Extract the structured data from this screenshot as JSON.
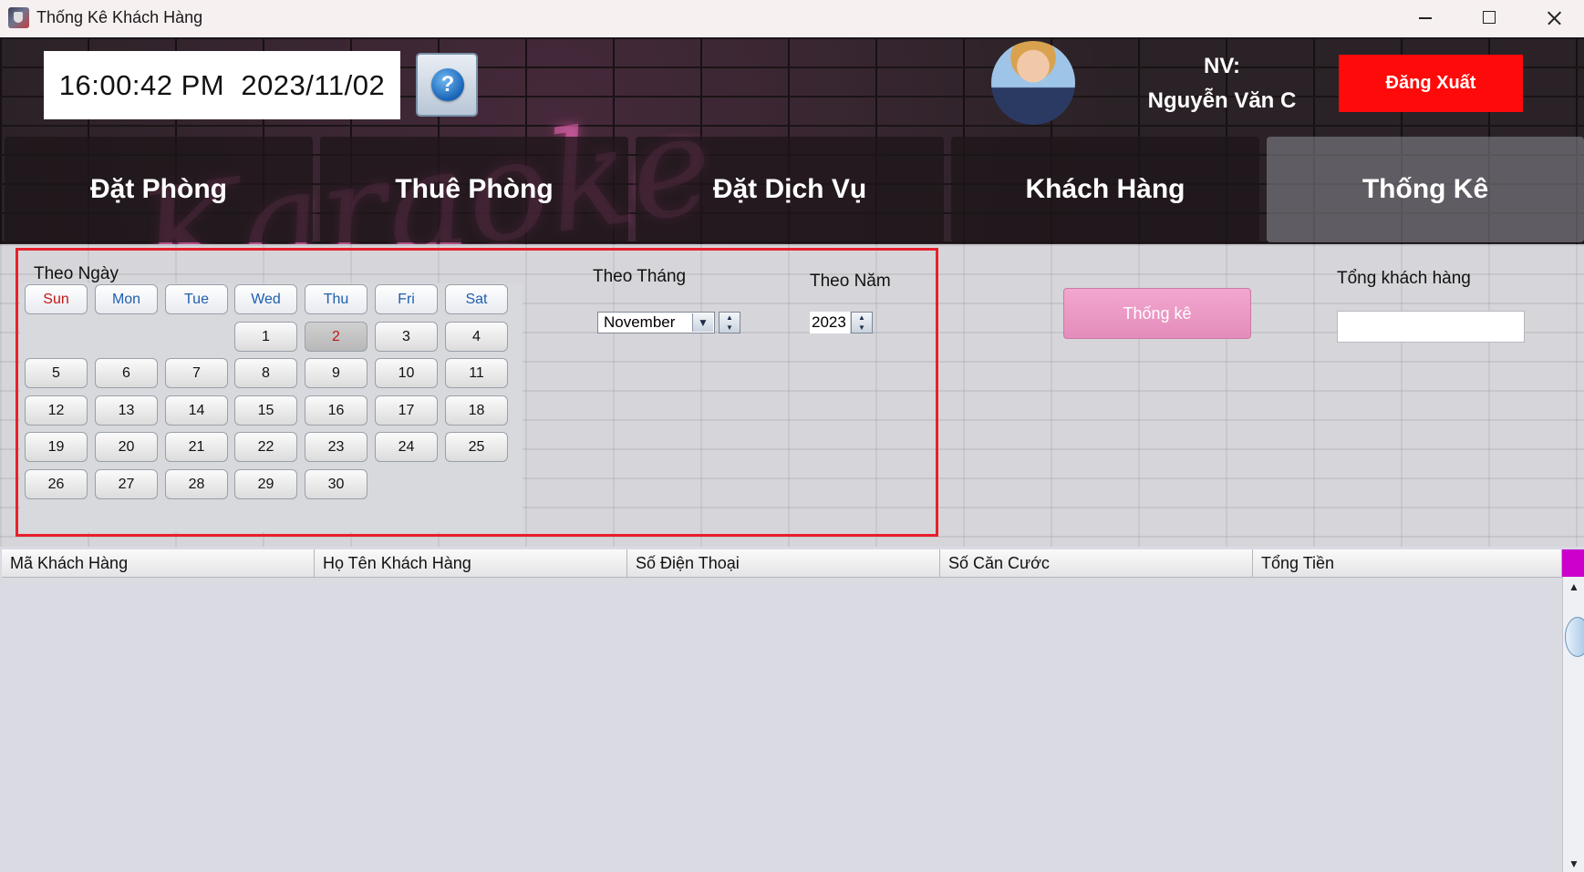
{
  "window": {
    "title": "Thống Kê Khách Hàng"
  },
  "header": {
    "time": "16:00:42 PM",
    "date": "2023/11/02",
    "help_icon": "?",
    "employee_label": "NV:",
    "employee_name": "Nguyễn Văn C",
    "logout_label": "Đăng Xuất"
  },
  "nav": {
    "tabs": [
      {
        "label": "Đặt Phòng"
      },
      {
        "label": "Thuê Phòng"
      },
      {
        "label": "Đặt Dịch Vụ"
      },
      {
        "label": "Khách Hàng"
      },
      {
        "label": "Thống Kê"
      }
    ]
  },
  "filters": {
    "date_label": "Theo Ngày",
    "month_label": "Theo Tháng",
    "month_value": "November",
    "year_label": "Theo Năm",
    "year_value": "2023",
    "stats_button": "Thống kê",
    "total_label": "Tổng khách hàng",
    "total_value": ""
  },
  "calendar": {
    "weekdays": [
      "Sun",
      "Mon",
      "Tue",
      "Wed",
      "Thu",
      "Fri",
      "Sat"
    ],
    "first_weekday_index": 3,
    "days_in_month": 30,
    "selected_day": 2
  },
  "table": {
    "columns": [
      "Mã Khách Hàng",
      "Họ Tên Khách Hàng",
      "Số Điện Thoại",
      "Số Căn Cước",
      "Tổng Tiền"
    ],
    "rows": []
  },
  "colors": {
    "logout": "#ff0a0a",
    "stats_button": "#ee9bc7",
    "highlight_frame": "#e8202c",
    "weekday_sun": "#c01818",
    "weekday": "#1f5fae"
  }
}
